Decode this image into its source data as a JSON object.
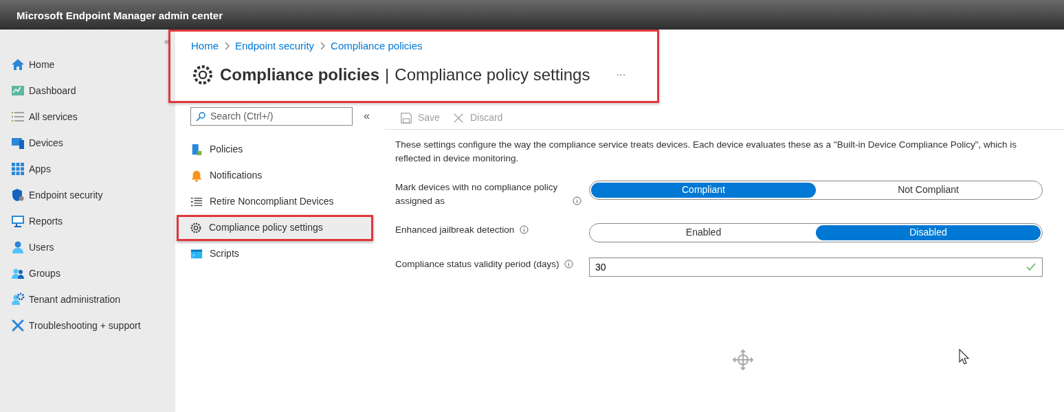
{
  "window": {
    "title": "Microsoft Endpoint Manager admin center"
  },
  "nav": {
    "collapse": "«",
    "items": [
      {
        "label": "Home"
      },
      {
        "label": "Dashboard"
      },
      {
        "label": "All services"
      },
      {
        "label": "Devices"
      },
      {
        "label": "Apps"
      },
      {
        "label": "Endpoint security"
      },
      {
        "label": "Reports"
      },
      {
        "label": "Users"
      },
      {
        "label": "Groups"
      },
      {
        "label": "Tenant administration"
      },
      {
        "label": "Troubleshooting + support"
      }
    ]
  },
  "breadcrumb": [
    "Home",
    "Endpoint security",
    "Compliance policies"
  ],
  "page_title": {
    "main": "Compliance policies",
    "separator": "|",
    "sub": "Compliance policy settings",
    "more": "···"
  },
  "menu": {
    "search": {
      "placeholder": "Search (Ctrl+/)"
    },
    "collapse": "«",
    "items": [
      {
        "label": "Policies",
        "selected": false
      },
      {
        "label": "Notifications",
        "selected": false
      },
      {
        "label": "Retire Noncompliant Devices",
        "selected": false
      },
      {
        "label": "Compliance policy settings",
        "selected": true
      },
      {
        "label": "Scripts",
        "selected": false
      }
    ]
  },
  "toolbar": [
    {
      "label": "Save",
      "disabled": true
    },
    {
      "label": "Discard",
      "disabled": true
    }
  ],
  "description": "These settings configure the way the compliance service treats devices. Each device evaluates these as a \"Built-in Device Compliance Policy\", which is reflected in device monitoring.",
  "settings": [
    {
      "kind": "toggle",
      "label": "Mark devices with no compliance policy assigned as",
      "options": [
        {
          "label": "Compliant",
          "selected": true
        },
        {
          "label": "Not Compliant",
          "selected": false
        }
      ]
    },
    {
      "kind": "toggle",
      "label": "Enhanced jailbreak detection",
      "options": [
        {
          "label": "Enabled",
          "selected": false
        },
        {
          "label": "Disabled",
          "selected": true
        }
      ]
    },
    {
      "kind": "text",
      "label": "Compliance status validity period (days)",
      "value": "30",
      "valid": true
    }
  ]
}
